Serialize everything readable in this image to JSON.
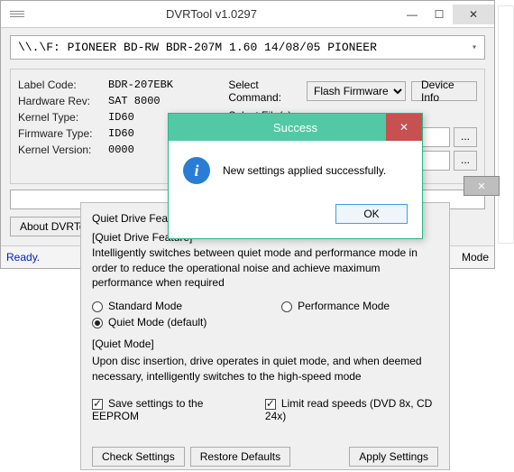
{
  "window": {
    "title": "DVRTool v1.0297"
  },
  "drive_line": "\\\\.\\F: PIONEER  BD-RW   BDR-207M 1.60  14/08/05  PIONEER",
  "info": {
    "label_code": {
      "lbl": "Label Code:",
      "val": "BDR-207EBK"
    },
    "hw_rev": {
      "lbl": "Hardware Rev:",
      "val": "SAT 8000"
    },
    "kernel_type": {
      "lbl": "Kernel Type:",
      "val": "ID60"
    },
    "fw_type": {
      "lbl": "Firmware Type:",
      "val": "ID60"
    },
    "kernel_ver": {
      "lbl": "Kernel Version:",
      "val": "0000"
    }
  },
  "right": {
    "select_cmd_lbl": "Select Command:",
    "select_cmd_val": "Flash Firmware",
    "device_info_btn": "Device Info",
    "select_files_lbl": "Select File(s):",
    "dots": "..."
  },
  "about_btn": "About DVRTool",
  "status": {
    "ready": "Ready.",
    "mode": "Mode"
  },
  "quiet": {
    "heading": "Quiet Drive Feature",
    "desc1": "[Quiet Drive Feature]",
    "desc2": "Intelligently switches between quiet mode and performance mode in order to reduce the operational noise and achieve maximum performance when required",
    "radio_std": "Standard Mode",
    "radio_perf": "Performance Mode",
    "radio_quiet": "Quiet Mode (default)",
    "mode_hdr": "[Quiet Mode]",
    "mode_desc": "Upon disc insertion, drive operates in quiet mode, and when deemed necessary, intelligently switches to the high-speed mode",
    "cb_save": "Save settings to the EEPROM",
    "cb_limit": "Limit read speeds (DVD 8x, CD 24x)",
    "btn_check": "Check Settings",
    "btn_restore": "Restore Defaults",
    "btn_apply": "Apply Settings"
  },
  "dialog": {
    "title": "Success",
    "msg": "New settings applied successfully.",
    "ok": "OK"
  }
}
